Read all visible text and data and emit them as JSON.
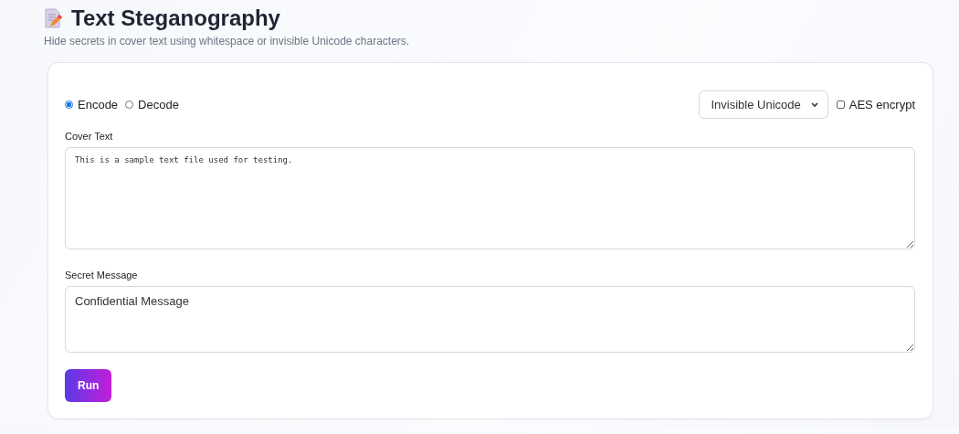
{
  "header": {
    "title": "Text Steganography",
    "subtitle": "Hide secrets in cover text using whitespace or invisible Unicode characters."
  },
  "modes": [
    {
      "label": "Encode",
      "selected": true
    },
    {
      "label": "Decode",
      "selected": false
    }
  ],
  "method": {
    "value": "Invisible Unicode"
  },
  "aes": {
    "label": "AES encrypt",
    "checked": false
  },
  "cover_text": {
    "label": "Cover Text",
    "value": "This is a sample text file used for testing."
  },
  "secret_message": {
    "label": "Secret Message",
    "value": "Confidential Message"
  },
  "run_button": "Run"
}
